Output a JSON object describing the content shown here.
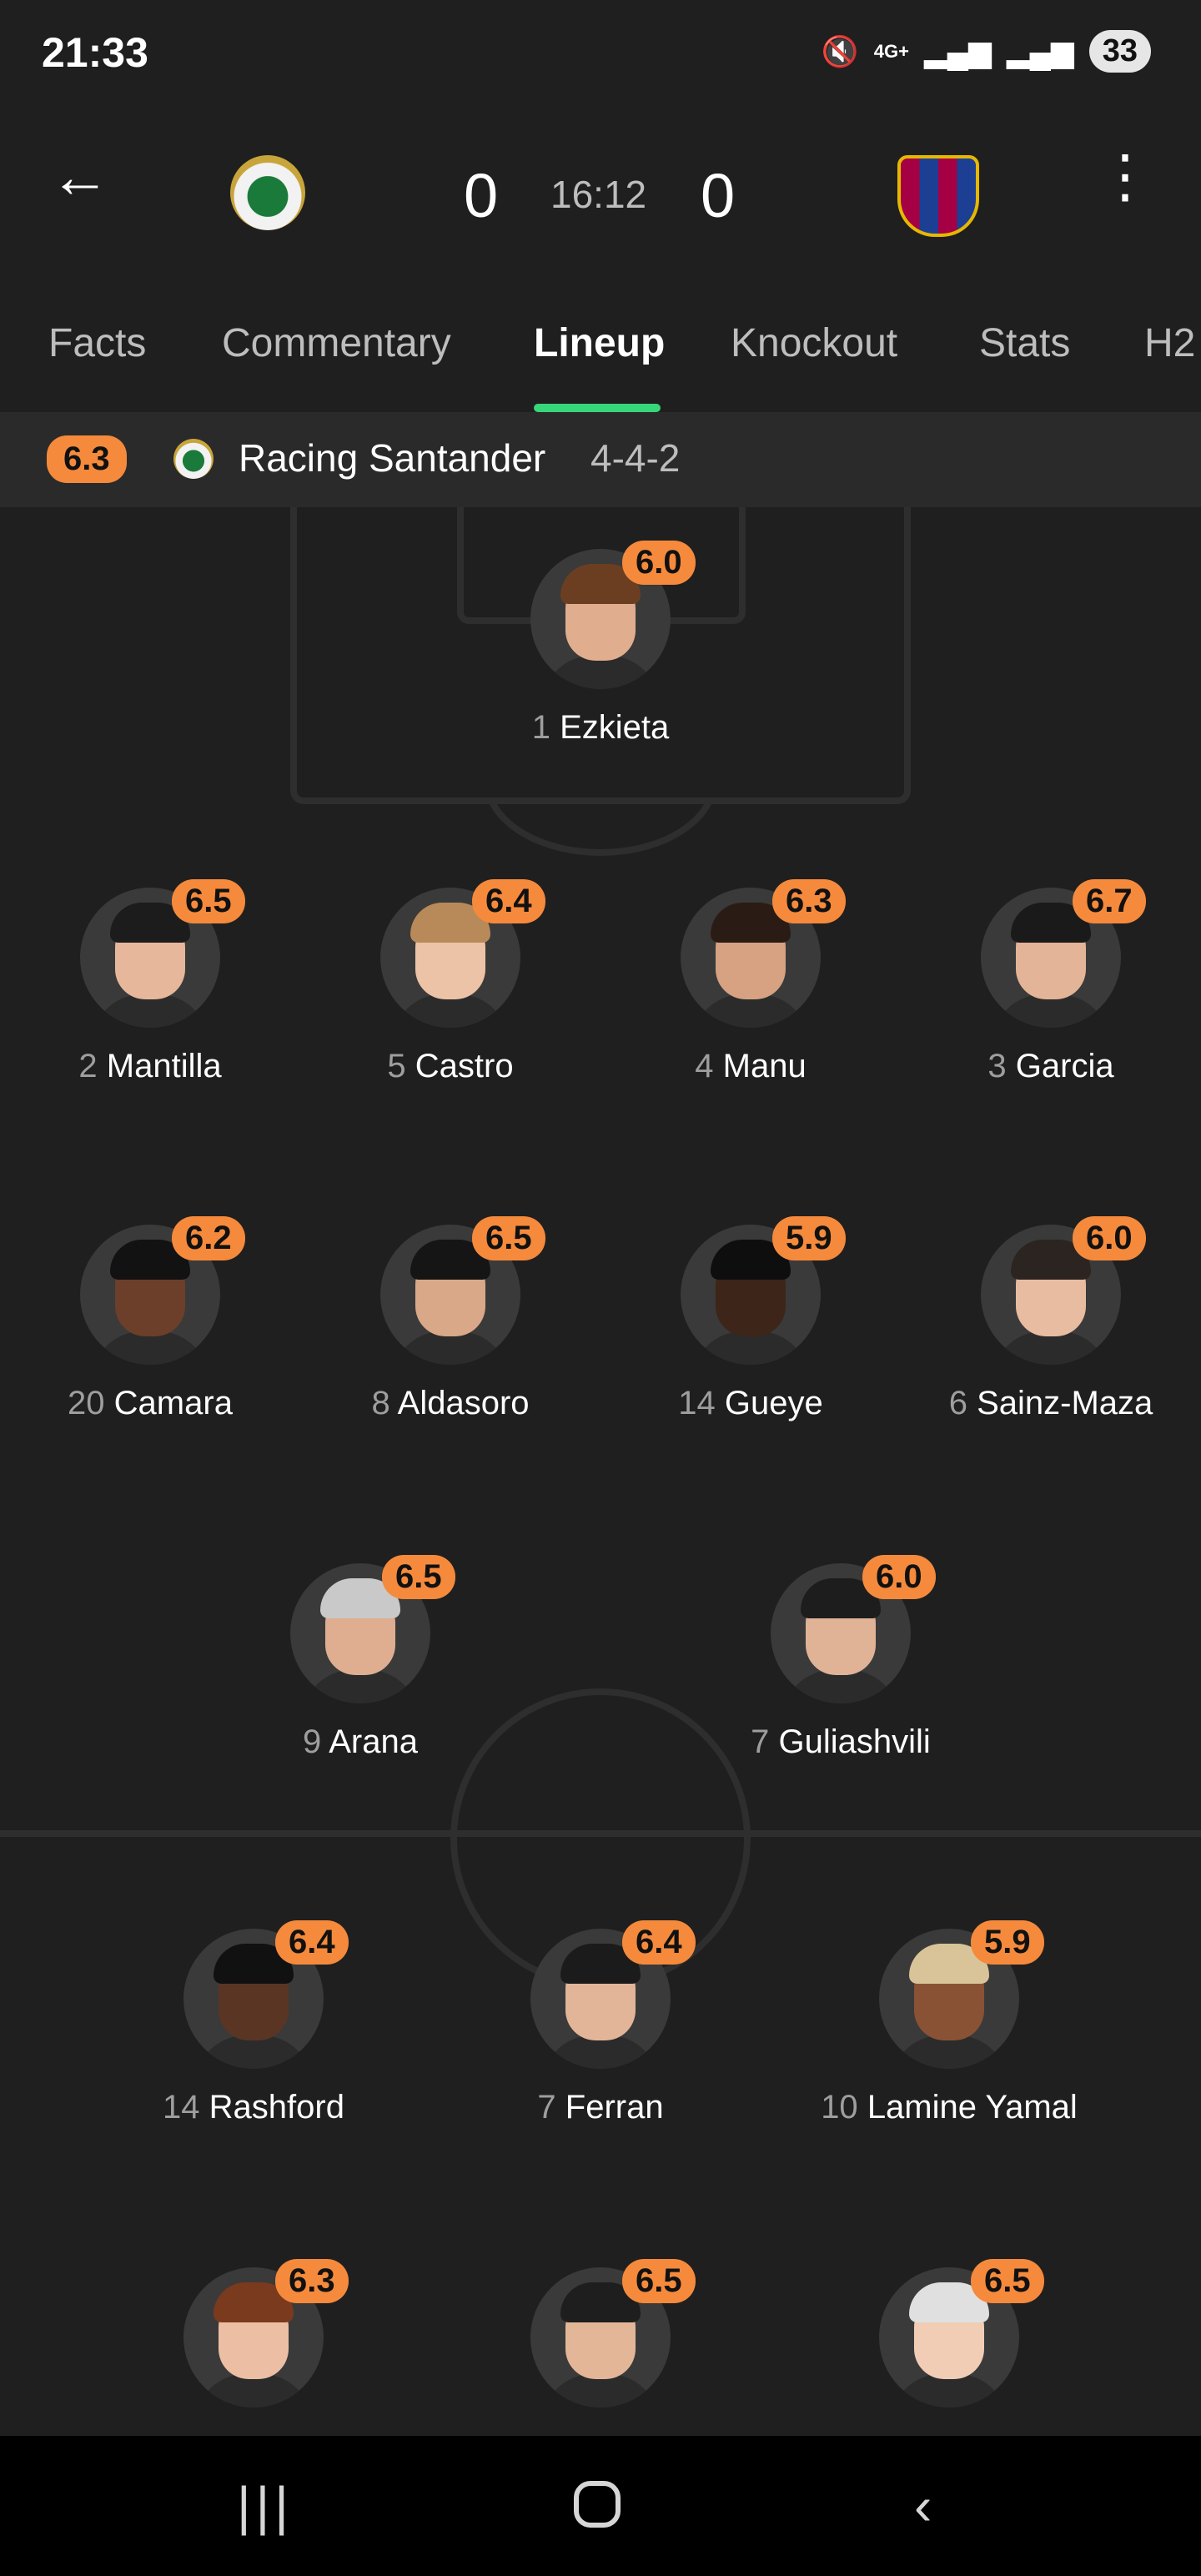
{
  "status_bar": {
    "time": "21:33",
    "network": "4G+",
    "battery": "33"
  },
  "match": {
    "home_score": "0",
    "away_score": "0",
    "clock": "16:12",
    "back_icon": "arrow-left-icon",
    "menu_icon": "more-vertical-icon"
  },
  "tabs": [
    "Facts",
    "Commentary",
    "Lineup",
    "Knockout",
    "Stats",
    "H2"
  ],
  "active_tab": "Lineup",
  "team": {
    "rating": "6.3",
    "name": "Racing Santander",
    "formation": "4-4-2"
  },
  "players": [
    {
      "number": "1",
      "name": "Ezkieta",
      "rating": "6.0",
      "skin": "#e0ae8f",
      "hair": "#6b3e22"
    },
    {
      "number": "2",
      "name": "Mantilla",
      "rating": "6.5",
      "skin": "#e6b79b",
      "hair": "#1c1c1c"
    },
    {
      "number": "5",
      "name": "Castro",
      "rating": "6.4",
      "skin": "#ecc3a6",
      "hair": "#b88a5a"
    },
    {
      "number": "4",
      "name": "Manu",
      "rating": "6.3",
      "skin": "#d6a282",
      "hair": "#2a1c14"
    },
    {
      "number": "3",
      "name": "Garcia",
      "rating": "6.7",
      "skin": "#e3b497",
      "hair": "#1a1a1a"
    },
    {
      "number": "20",
      "name": "Camara",
      "rating": "6.2",
      "skin": "#6b3f2a",
      "hair": "#121212"
    },
    {
      "number": "8",
      "name": "Aldasoro",
      "rating": "6.5",
      "skin": "#d9a888",
      "hair": "#151515"
    },
    {
      "number": "14",
      "name": "Gueye",
      "rating": "5.9",
      "skin": "#3d2519",
      "hair": "#0e0e0e"
    },
    {
      "number": "6",
      "name": "Sainz-Maza",
      "rating": "6.0",
      "skin": "#e8bca0",
      "hair": "#2c2420"
    },
    {
      "number": "9",
      "name": "Arana",
      "rating": "6.5",
      "skin": "#dfae90",
      "hair": "#c9c9c9"
    },
    {
      "number": "7",
      "name": "Guliashvili",
      "rating": "6.0",
      "skin": "#e0b296",
      "hair": "#1d1d1d"
    },
    {
      "number": "14",
      "name": "Rashford",
      "rating": "6.4",
      "skin": "#5a3524",
      "hair": "#111111"
    },
    {
      "number": "7",
      "name": "Ferran",
      "rating": "6.4",
      "skin": "#e2b598",
      "hair": "#1b1b1b"
    },
    {
      "number": "10",
      "name": "Lamine Yamal",
      "rating": "5.9",
      "skin": "#8a5234",
      "hair": "#d9c49a"
    },
    {
      "number": "",
      "name": "",
      "rating": "6.3",
      "skin": "#ecbfa4",
      "hair": "#7a3a1e"
    },
    {
      "number": "",
      "name": "",
      "rating": "6.5",
      "skin": "#e4b698",
      "hair": "#1e1e1e"
    },
    {
      "number": "",
      "name": "",
      "rating": "6.5",
      "skin": "#f0cdb4",
      "hair": "#e0e0e0"
    }
  ],
  "colors": {
    "accent_rating": "#f58a3c",
    "tab_indicator": "#37d67a",
    "background": "#1f1f1f"
  },
  "nav": {
    "recents_icon": "recent-apps-icon",
    "home_icon": "home-icon",
    "back_icon": "back-chevron-icon"
  }
}
